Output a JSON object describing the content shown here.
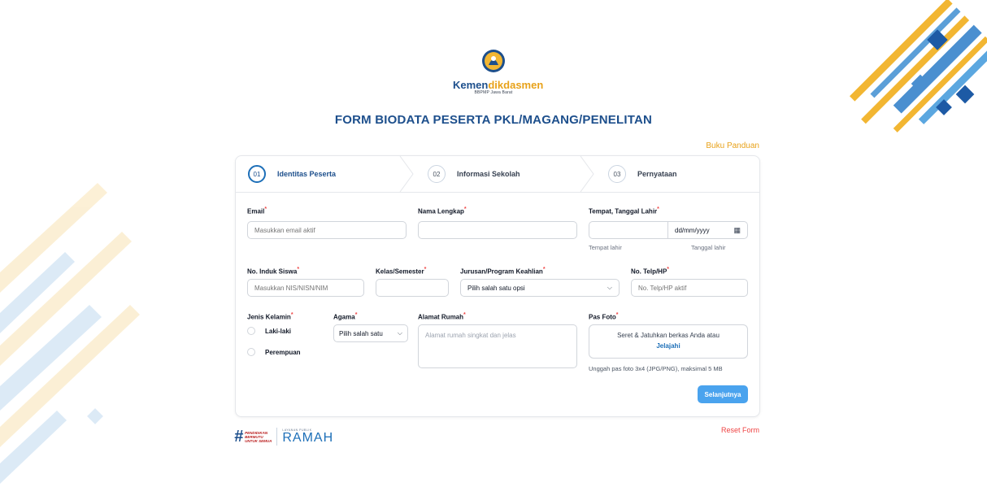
{
  "header": {
    "logo_part1": "Kemen",
    "logo_part2": "dikdasmen",
    "logo_sub": "BBPMP Jawa Barat",
    "title": "FORM BIODATA PESERTA PKL/MAGANG/PENELITAN",
    "guide_link": "Buku Panduan"
  },
  "steps": [
    {
      "num": "01",
      "label": "Identitas Peserta",
      "active": true
    },
    {
      "num": "02",
      "label": "Informasi Sekolah",
      "active": false
    },
    {
      "num": "03",
      "label": "Pernyataan",
      "active": false
    }
  ],
  "form": {
    "email": {
      "label": "Email",
      "placeholder": "Masukkan email aktif",
      "value": ""
    },
    "full_name": {
      "label": "Nama Lengkap",
      "value": ""
    },
    "birth": {
      "label": "Tempat, Tanggal Lahir",
      "place_hint": "Tempat lahir",
      "date_hint": "Tanggal lahir",
      "date_value": "dd/mm/yyyy"
    },
    "student_id": {
      "label": "No. Induk Siswa",
      "placeholder": "Masukkan NIS/NISN/NIM"
    },
    "class": {
      "label": "Kelas/Semester",
      "value": ""
    },
    "major": {
      "label": "Jurusan/Program Keahlian",
      "selected": "Pilih salah satu opsi"
    },
    "phone": {
      "label": "No. Telp/HP",
      "placeholder": "No. Telp/HP aktif"
    },
    "gender": {
      "label": "Jenis Kelamin",
      "options": [
        "Laki-laki",
        "Perempuan"
      ]
    },
    "religion": {
      "label": "Agama",
      "selected": "Pilih salah satu"
    },
    "address": {
      "label": "Alamat Rumah",
      "placeholder": "Alamat rumah singkat dan jelas"
    },
    "photo": {
      "label": "Pas Foto",
      "drop_text": "Seret & Jatuhkan berkas Anda atau",
      "browse": "Jelajahi",
      "hint": "Unggah pas foto 3x4 (JPG/PNG), maksimal 5 MB"
    },
    "required_mark": "*",
    "next_button": "Selanjutnya"
  },
  "footer": {
    "reset": "Reset Form",
    "hashtag_lines": [
      "PENDIDIKAN",
      "BERMUTU",
      "UNTUK SEMUA"
    ],
    "ramah_sup": "LAYANAN PUBLIK",
    "ramah": "RAMAH"
  },
  "colors": {
    "primary": "#1d4f8c",
    "accent": "#e8a21a",
    "button": "#4aa3ee",
    "danger": "#ef4444"
  }
}
